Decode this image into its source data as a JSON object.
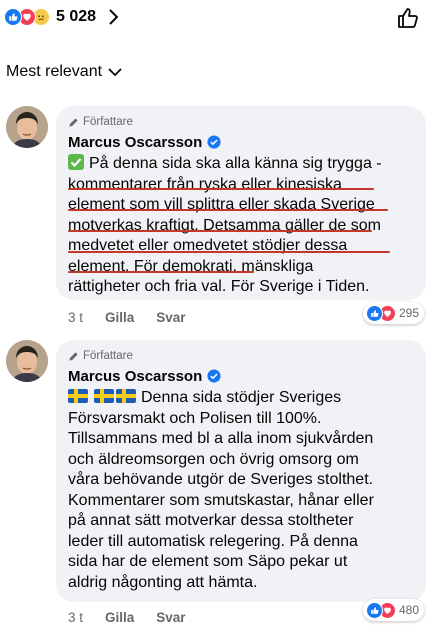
{
  "header": {
    "reaction_count": "5 028",
    "reactions": [
      "like-reaction",
      "love-reaction",
      "sad-reaction"
    ]
  },
  "sort": {
    "label": "Mest relevant"
  },
  "comments": [
    {
      "author_tag": "Författare",
      "author": "Marcus Oscarsson",
      "lines": [
        "På denna sida ska alla känna sig trygga -",
        "kommentarer från ryska eller kinesiska",
        "element som vill splittra eller skada Sverige",
        "motverkas kraftigt. Detsamma gäller de som",
        "medvetet eller omedvetet stödjer dessa",
        "element. För demokrati, mänskliga",
        "rättigheter och fria val. För Sverige i Tiden."
      ],
      "time": "3 t",
      "like_label": "Gilla",
      "reply_label": "Svar",
      "reaction_count": "295"
    },
    {
      "author_tag": "Författare",
      "author": "Marcus Oscarsson",
      "lines": [
        "Denna sida stödjer Sveriges",
        "Försvarsmakt och Polisen till 100%.",
        "Tillsammans med bl a alla inom sjukvården",
        "och äldreomsorgen och övrig omsorg om",
        "våra behövande utgör de Sveriges stolthet.",
        "Kommentarer som smutskastar, hånar eller",
        "på annat sätt motverkar dessa stoltheter",
        "leder till automatisk relegering. På denna",
        "sida har de element som Säpo pekar ut",
        "aldrig någonting att hämta."
      ],
      "time": "3 t",
      "like_label": "Gilla",
      "reply_label": "Svar",
      "reaction_count": "480"
    }
  ],
  "colors": {
    "facebook_blue": "#1877f2",
    "love_red": "#f33e58",
    "bubble_bg": "#f0f2f5",
    "underline_red": "#c0392b"
  }
}
